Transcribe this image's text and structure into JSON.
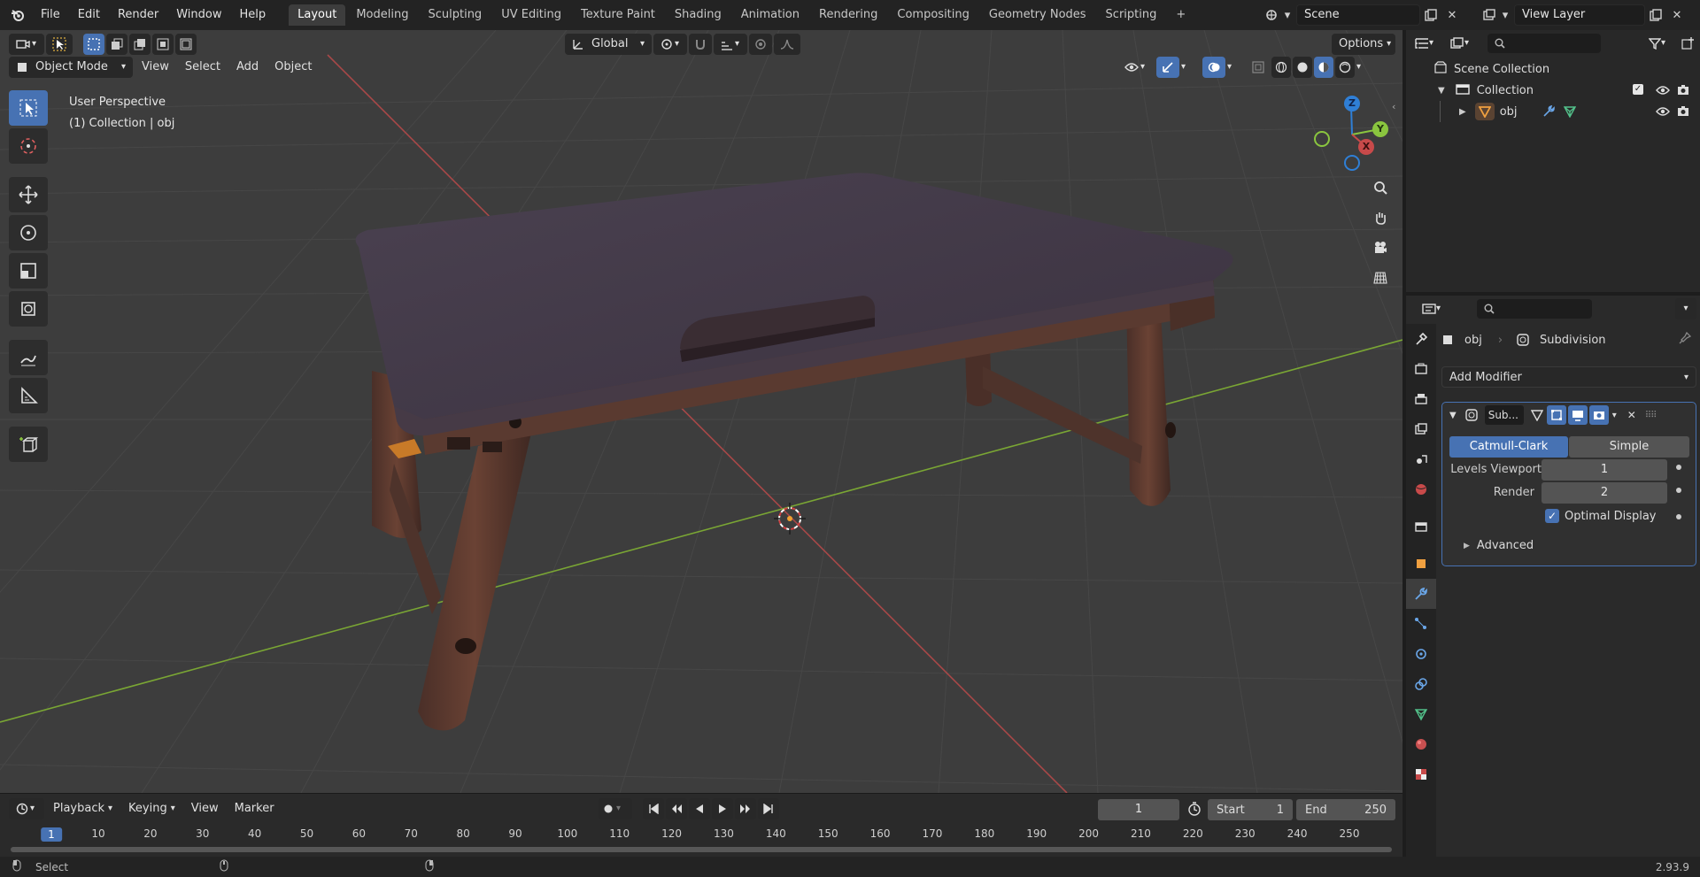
{
  "menu": {
    "items": [
      "File",
      "Edit",
      "Render",
      "Window",
      "Help"
    ],
    "workspaces": [
      "Layout",
      "Modeling",
      "Sculpting",
      "UV Editing",
      "Texture Paint",
      "Shading",
      "Animation",
      "Rendering",
      "Compositing",
      "Geometry Nodes",
      "Scripting"
    ],
    "active_workspace": "Layout",
    "add_tab": "+",
    "scene": "Scene",
    "view_layer": "View Layer"
  },
  "viewport": {
    "orientation": "Global",
    "options_label": "Options",
    "mode": "Object Mode",
    "menus": [
      "View",
      "Select",
      "Add",
      "Object"
    ],
    "overlay_line1": "User Perspective",
    "overlay_line2": "(1) Collection | obj",
    "gizmo": {
      "x": "X",
      "y": "Y",
      "z": "Z"
    }
  },
  "outliner": {
    "search_placeholder": "",
    "scene_collection": "Scene Collection",
    "collection": "Collection",
    "object": "obj"
  },
  "properties": {
    "object_name": "obj",
    "modifier_name": "Subdivision",
    "add_modifier": "Add Modifier",
    "panel_name": "Sub...",
    "method_options": [
      "Catmull-Clark",
      "Simple"
    ],
    "active_method": "Catmull-Clark",
    "levels_viewport_label": "Levels Viewport",
    "levels_viewport_value": "1",
    "render_label": "Render",
    "render_value": "2",
    "optimal_display_label": "Optimal Display",
    "optimal_display_checked": true,
    "advanced_label": "Advanced"
  },
  "timeline": {
    "menus": [
      "Playback",
      "Keying",
      "View",
      "Marker"
    ],
    "current_frame": "1",
    "start_label": "Start",
    "start_value": "1",
    "end_label": "End",
    "end_value": "250",
    "ruler": [
      "1",
      "10",
      "20",
      "30",
      "40",
      "50",
      "60",
      "70",
      "80",
      "90",
      "100",
      "110",
      "120",
      "130",
      "140",
      "150",
      "160",
      "170",
      "180",
      "190",
      "200",
      "210",
      "220",
      "230",
      "240",
      "250"
    ]
  },
  "status": {
    "left_label": "Select",
    "version": "2.93.9"
  },
  "colors": {
    "accent": "#4772b3",
    "x_axis": "#c84a4a",
    "y_axis": "#8ac53f",
    "z_axis": "#2f7fd6"
  }
}
